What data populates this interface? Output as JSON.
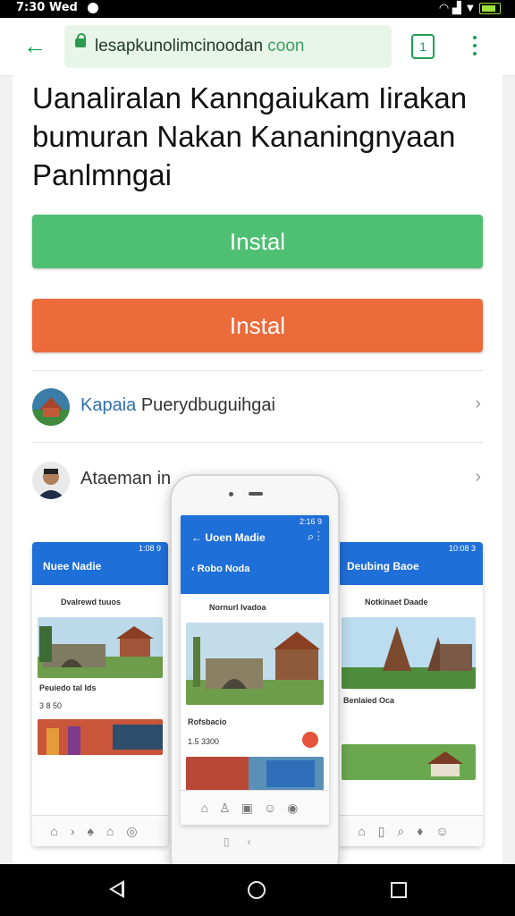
{
  "status": {
    "time": "7:30 Wed"
  },
  "browser": {
    "url_main": "lesapkunolimcinoodan ",
    "url_tail": "coon"
  },
  "page": {
    "title": "Uanaliralan Kanngaiukam Iirakan bumuran Nakan Kananingnyaan Panlmngai",
    "install_green": "Instal",
    "install_orange": "Instal",
    "row1": {
      "highlight": "Kapaia",
      "rest": " Pueryd​buguihgai"
    },
    "row2": {
      "label": "Ataeman in"
    }
  },
  "screens": {
    "left": {
      "title": "Nuee Nadie",
      "status": "1:08 9",
      "post_title": "Dvalrewd tuuos",
      "caption": "Peuiedo tal Ids",
      "meta": "3 8 50"
    },
    "center": {
      "title": "Uoen Madie",
      "sub_title": "Robo Noda",
      "status": "2:16 9",
      "post_title": "Nornurl Ivadoa",
      "caption": "Rofsbacio",
      "meta": "1.5 3300"
    },
    "right": {
      "title": "Deubing Baoe",
      "status": "10:08 3",
      "post_title": "Notkinaet Daade",
      "caption": "Benlaied Oca"
    }
  },
  "colors": {
    "green": "#4ebf73",
    "orange": "#ec6b3b",
    "appbar": "#1f6fd8"
  }
}
